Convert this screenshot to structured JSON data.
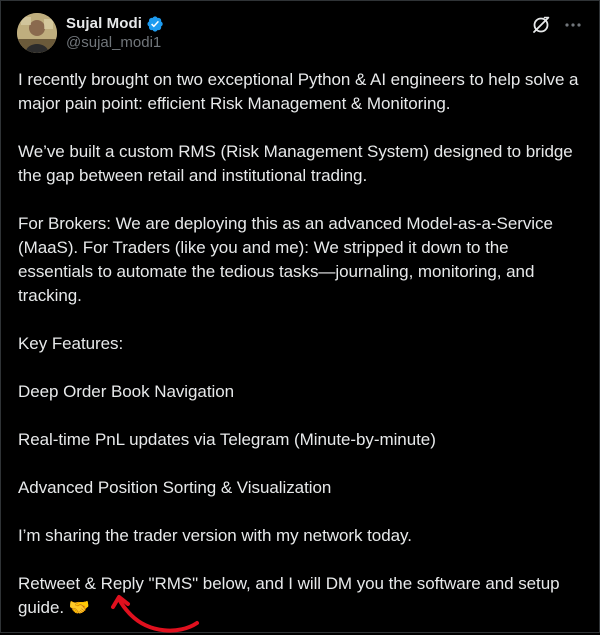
{
  "author": {
    "display_name": "Sujal Modi",
    "handle": "@sujal_modi1",
    "verified": true
  },
  "icons": {
    "avatar": "avatar",
    "verified": "verified-badge-icon",
    "grok": "grok-icon",
    "more": "more-icon"
  },
  "colors": {
    "background": "#000000",
    "text": "#e7e9ea",
    "secondary_text": "#71767b",
    "verified_blue": "#1d9bf0",
    "annotation_red": "#e0101e"
  },
  "tweet": {
    "paragraphs": [
      "I recently brought on two exceptional Python & AI engineers to help solve a major pain point: efficient Risk Management & Monitoring.",
      "We’ve built a custom RMS (Risk Management System) designed to bridge the gap between retail and institutional trading.",
      "For Brokers: We are deploying this as an advanced Model-as-a-Service (MaaS). For Traders (like you and me): We stripped it down to the essentials to automate the tedious tasks—journaling, monitoring, and tracking.",
      "Key Features:",
      "Deep Order Book Navigation",
      "Real-time PnL updates via Telegram (Minute-by-minute)",
      "Advanced Position Sorting & Visualization",
      "I’m sharing the trader version with my network today.",
      "Retweet & Reply \"RMS\" below, and I will DM you the software and setup guide. 🤝"
    ]
  }
}
